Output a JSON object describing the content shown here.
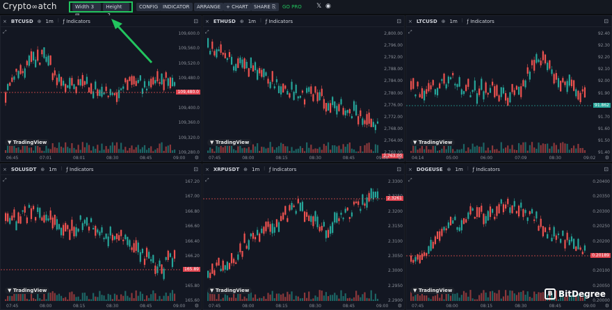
{
  "app": {
    "logo": "CryptoWatch",
    "logo_prefix": "Crypto",
    "logo_suffix": "atch"
  },
  "toolbar": {
    "width_label": "Width",
    "width_value": "3",
    "height_label": "Height",
    "height_value": "2",
    "config": "CONFIG",
    "indicator": "INDICATOR",
    "arrange": "ARRANGE",
    "add_chart": "+ CHART",
    "share": "SHARE",
    "go_pro": "GO PRO",
    "x_icon": "x-icon",
    "discord_icon": "discord-icon"
  },
  "colors": {
    "up": "#26a69a",
    "down": "#ef5350",
    "accent_green": "#22c55e",
    "price_tag": "#e0444f"
  },
  "panels": [
    {
      "symbol": "BTCUSD",
      "interval": "1m",
      "indicators": "Indicators",
      "watermark": "TradingView",
      "price_axis": [
        "109,600.0",
        "109,560.0",
        "109,520.0",
        "109,480.0",
        "109,440.0",
        "109,400.0",
        "109,360.0",
        "109,320.0",
        "109,280.0"
      ],
      "current_price": "109,480.0",
      "time_axis": [
        "06:45",
        "07:01",
        "08:01",
        "08:30",
        "08:45",
        "09:00"
      ]
    },
    {
      "symbol": "ETHUSD",
      "interval": "1m",
      "indicators": "Indicators",
      "watermark": "TradingView",
      "price_axis": [
        "2,800.00",
        "2,796.00",
        "2,792.00",
        "2,788.00",
        "2,784.00",
        "2,780.00",
        "2,776.00",
        "2,772.00",
        "2,768.00",
        "2,764.00",
        "2,760.00"
      ],
      "current_price": "2,763.00",
      "time_axis": [
        "07:45",
        "08:00",
        "08:15",
        "08:30",
        "08:45",
        "09:00"
      ]
    },
    {
      "symbol": "LTCUSD",
      "interval": "1m",
      "indicators": "Indicators",
      "watermark": "TradingView",
      "price_axis": [
        "92.40",
        "92.30",
        "92.20",
        "92.10",
        "92.00",
        "91.90",
        "91.80",
        "91.70",
        "91.60",
        "91.50",
        "91.40"
      ],
      "current_price": "91.862",
      "time_axis": [
        "04:14",
        "05:00",
        "06:00",
        "07:09",
        "08:30",
        "09:02"
      ]
    },
    {
      "symbol": "SOLUSDT",
      "interval": "1m",
      "indicators": "Indicators",
      "watermark": "TradingView",
      "price_axis": [
        "167.20",
        "167.00",
        "166.80",
        "166.60",
        "166.40",
        "166.20",
        "166.00",
        "165.80",
        "165.60"
      ],
      "current_price": "165.89",
      "time_axis": [
        "07:45",
        "08:00",
        "08:15",
        "08:30",
        "08:45",
        "09:00"
      ]
    },
    {
      "symbol": "XRPUSDT",
      "interval": "1m",
      "indicators": "Indicators",
      "watermark": "TradingView",
      "price_axis": [
        "2.3300",
        "2.3250",
        "2.3200",
        "2.3150",
        "2.3100",
        "2.3050",
        "2.3000",
        "2.2950",
        "2.2900"
      ],
      "current_price": "2.3261",
      "time_axis": [
        "07:45",
        "08:00",
        "08:15",
        "08:30",
        "08:45",
        "09:00"
      ]
    },
    {
      "symbol": "DOGEUSE",
      "interval": "1m",
      "indicators": "Indicators",
      "watermark": "TradingView",
      "price_axis": [
        "0.20400",
        "0.20350",
        "0.20300",
        "0.20250",
        "0.20200",
        "0.20150",
        "0.20100",
        "0.20050",
        "0.20000"
      ],
      "current_price": "0.20189",
      "time_axis": [
        "07:45",
        "08:00",
        "08:15",
        "08:30",
        "08:45",
        "09:00"
      ]
    }
  ],
  "branding": {
    "badge": "B",
    "name": "BitDegree"
  }
}
